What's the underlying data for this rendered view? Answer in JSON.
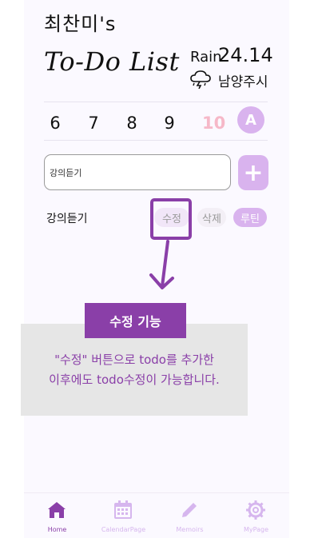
{
  "header": {
    "username": "최찬미's",
    "title": "To-Do List"
  },
  "weather": {
    "condition": "Rain",
    "temperature": "24.14",
    "city": "남양주시",
    "icon": "thunderstorm-cloud-icon"
  },
  "week": {
    "dates": [
      "6",
      "7",
      "8",
      "9",
      "10"
    ],
    "today": "10",
    "avatar_label": "A"
  },
  "todo_input": {
    "value": "강의듣기"
  },
  "todo_item": {
    "text": "강의듣기",
    "edit_label": "수정",
    "delete_label": "삭제",
    "routine_label": "루틴"
  },
  "annotation": {
    "title": "수정 기능",
    "line1": "\"수정\" 버튼으로 todo를 추가한",
    "line2": "이후에도 todo수정이 가능합니다."
  },
  "nav": {
    "items": [
      {
        "label": "Home",
        "icon": "home-icon",
        "active": true
      },
      {
        "label": "CalendarPage",
        "icon": "calendar-icon",
        "active": false
      },
      {
        "label": "Memoirs",
        "icon": "pencil-icon",
        "active": false
      },
      {
        "label": "MyPage",
        "icon": "gear-icon",
        "active": false
      }
    ]
  },
  "colors": {
    "accent": "#8a3fa8",
    "light_accent": "#d9b3ee",
    "today": "#f6b8c8"
  }
}
